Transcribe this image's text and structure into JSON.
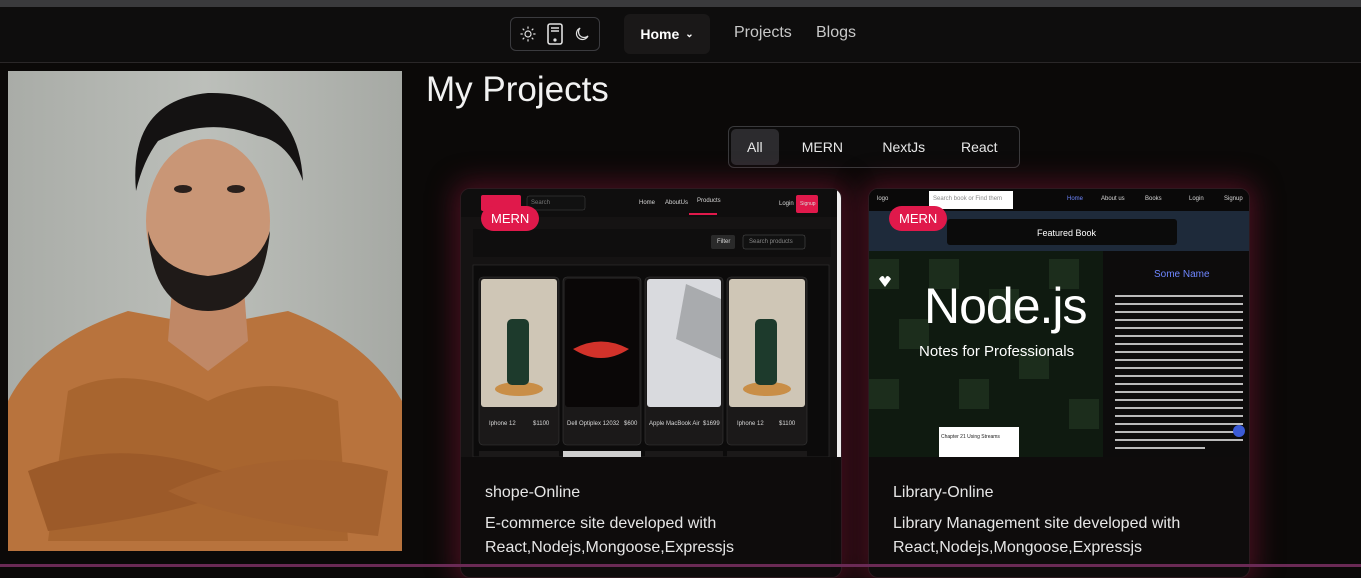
{
  "theme_switcher": {
    "options": [
      "sun-icon",
      "device-icon",
      "moon-icon"
    ]
  },
  "nav": {
    "home": "Home",
    "projects": "Projects",
    "blogs": "Blogs"
  },
  "page_title": "My Projects",
  "filters": [
    "All",
    "MERN",
    "NextJs",
    "React"
  ],
  "active_filter": "All",
  "colors": {
    "accent": "#e0194b",
    "background": "#0b0908",
    "card": "#0e0c0c"
  },
  "projects": [
    {
      "badge": "MERN",
      "name": "shope-Online",
      "description": "E-commerce site developed with React,Nodejs,Mongoose,Expressjs",
      "preview": {
        "nav_items": [
          "Home",
          "AboutUs",
          "Products",
          "Login",
          "Signup"
        ],
        "search_placeholder": "Search",
        "filter_label": "Filter",
        "search_products": "Search products",
        "products": [
          {
            "name": "Iphone 12",
            "price": "$1100"
          },
          {
            "name": "Dell Optiplex 12032",
            "price": "$600"
          },
          {
            "name": "Apple MacBook Air",
            "price": "$1699"
          },
          {
            "name": "Iphone 12",
            "price": "$1100"
          }
        ]
      }
    },
    {
      "badge": "MERN",
      "name": "Library-Online",
      "description": "Library Management site developed with React,Nodejs,Mongoose,Expressjs",
      "preview": {
        "logo": "logo",
        "search_placeholder": "Search book or Find them",
        "nav_items": [
          "Home",
          "About us",
          "Books",
          "Login",
          "Signup"
        ],
        "featured": "Featured Book",
        "book_title": "Node.js",
        "book_subtitle": "Notes for Professionals",
        "author": "Some Name",
        "chapter": "Chapter 21 Using Streams"
      }
    }
  ]
}
